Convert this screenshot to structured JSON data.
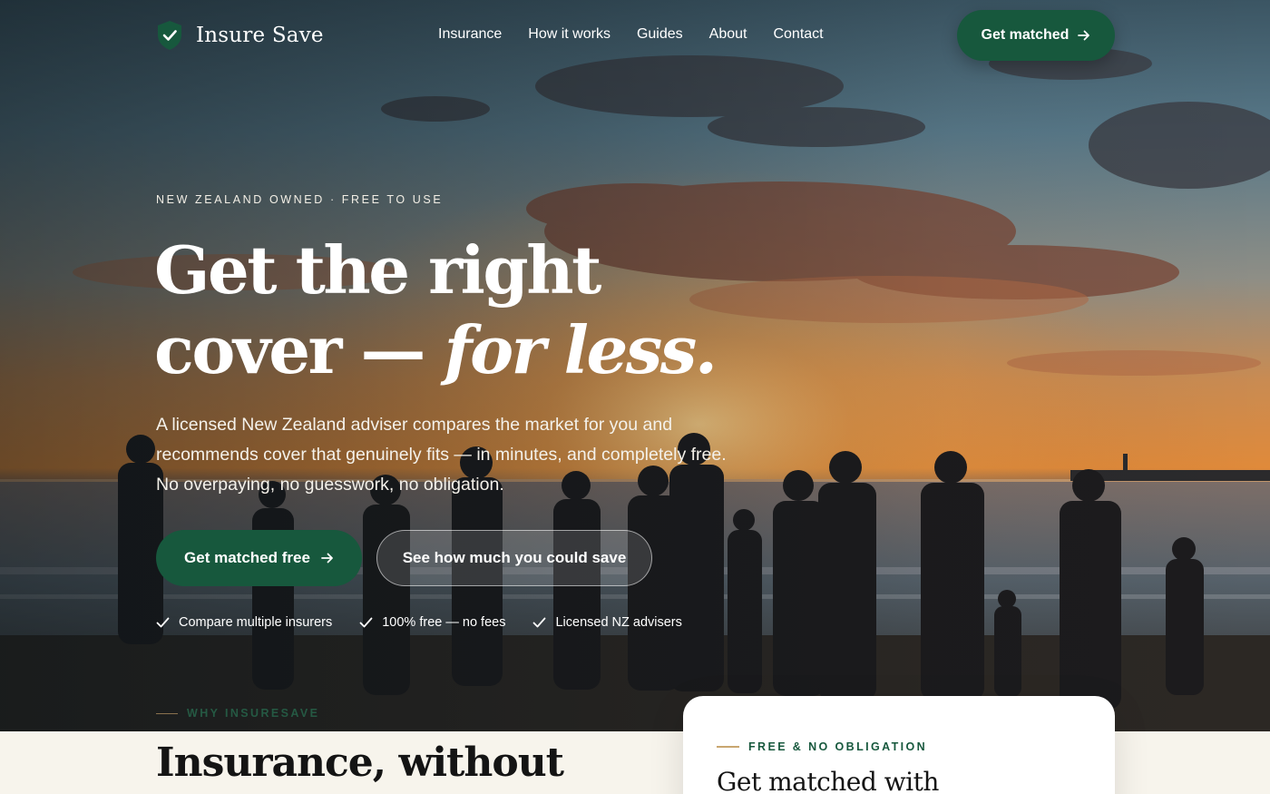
{
  "brand": {
    "name": "Insure Save"
  },
  "nav": {
    "items": [
      "Insurance",
      "How it works",
      "Guides",
      "About",
      "Contact"
    ],
    "cta_label": "Get matched"
  },
  "hero": {
    "eyebrow": "NEW ZEALAND OWNED · FREE TO USE",
    "headline_line1": "Get the right",
    "headline_line2_plain": "cover —",
    "headline_line2_italic": "for less.",
    "lead": "A licensed New Zealand adviser compares the market for you and recommends cover that genuinely fits — in minutes, and completely free. No overpaying, no guesswork, no obligation.",
    "primary_cta": "Get matched free",
    "secondary_cta": "See how much you could save",
    "checks": [
      "Compare multiple insurers",
      "100% free — no fees",
      "Licensed NZ advisers"
    ]
  },
  "why": {
    "eyebrow": "WHY INSURESAVE",
    "title": "Insurance, without"
  },
  "card": {
    "tag": "FREE & NO OBLIGATION",
    "title": "Get matched with"
  },
  "colors": {
    "brand_green": "#17583d",
    "accent_gold": "#c9a670",
    "cream": "#f7f4ec"
  }
}
